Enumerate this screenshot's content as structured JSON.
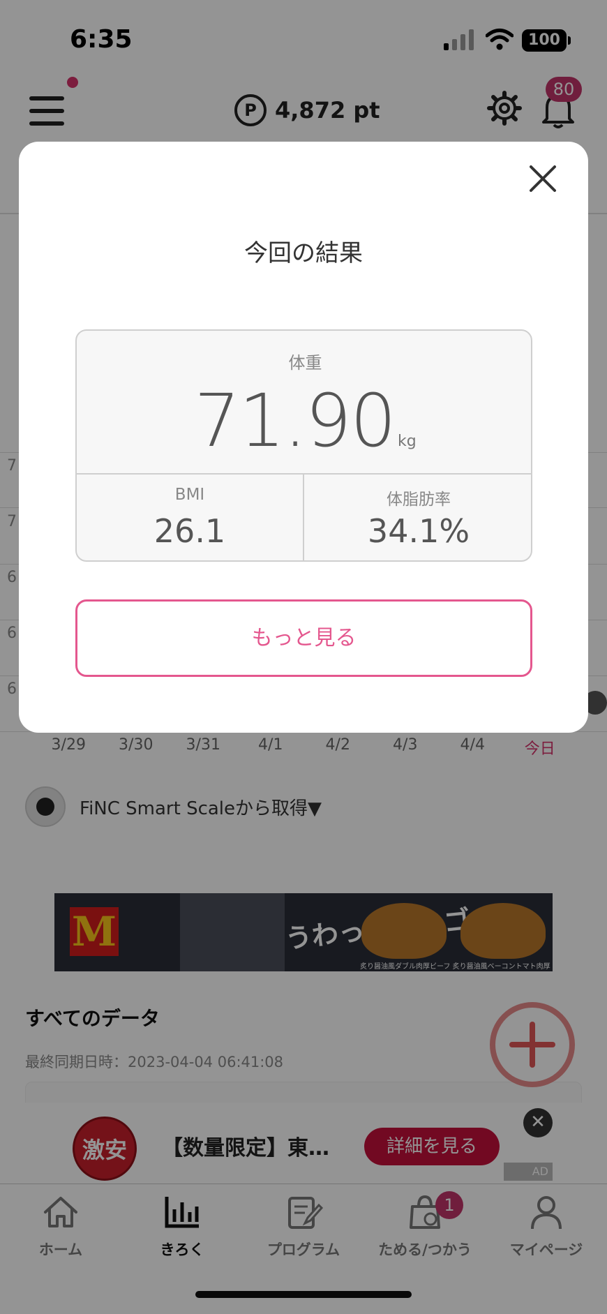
{
  "status": {
    "time": "6:35",
    "battery": "100"
  },
  "header": {
    "points": "4,872 pt",
    "points_symbol": "P",
    "notification_count": "80"
  },
  "graph": {
    "y_ticks": [
      "7",
      "7",
      "6",
      "6",
      "6"
    ],
    "x_labels": [
      "3/29",
      "3/30",
      "3/31",
      "4/1",
      "4/2",
      "4/3",
      "4/4",
      "今日"
    ]
  },
  "source": {
    "text": "FiNC Smart Scaleから取得▼"
  },
  "banner_ad": {
    "logo": "M",
    "copy": "うわっ肉厚スゴイ!",
    "small_text": "炙り醤油風ダブル肉厚ビーフ   炙り醤油風ベーコントマト肉厚ビーフ"
  },
  "all_data": {
    "title": "すべてのデータ",
    "sync": "最終同期日時：2023-04-04 06:41:08"
  },
  "bottom_ad": {
    "badge": "激安",
    "text": "【数量限定】東…",
    "button": "詳細を見る",
    "close": "✕",
    "tag": "AD"
  },
  "tabbar": {
    "items": [
      {
        "label": "ホーム",
        "icon": "home-icon"
      },
      {
        "label": "きろく",
        "icon": "chart-icon"
      },
      {
        "label": "プログラム",
        "icon": "program-icon"
      },
      {
        "label": "ためる/つかう",
        "icon": "shopping-bag-icon"
      },
      {
        "label": "マイページ",
        "icon": "person-icon"
      }
    ],
    "badge": "1",
    "active_index": 1
  },
  "modal": {
    "title": "今回の結果",
    "weight_label": "体重",
    "weight_value": "71.90",
    "weight_unit": "kg",
    "bmi_label": "BMI",
    "bmi_value": "26.1",
    "fat_label": "体脂肪率",
    "fat_value": "34.1%",
    "more_button": "もっと見る"
  },
  "colors": {
    "accent": "#e4578e",
    "badge": "#c2356a",
    "today": "#d6336c"
  }
}
